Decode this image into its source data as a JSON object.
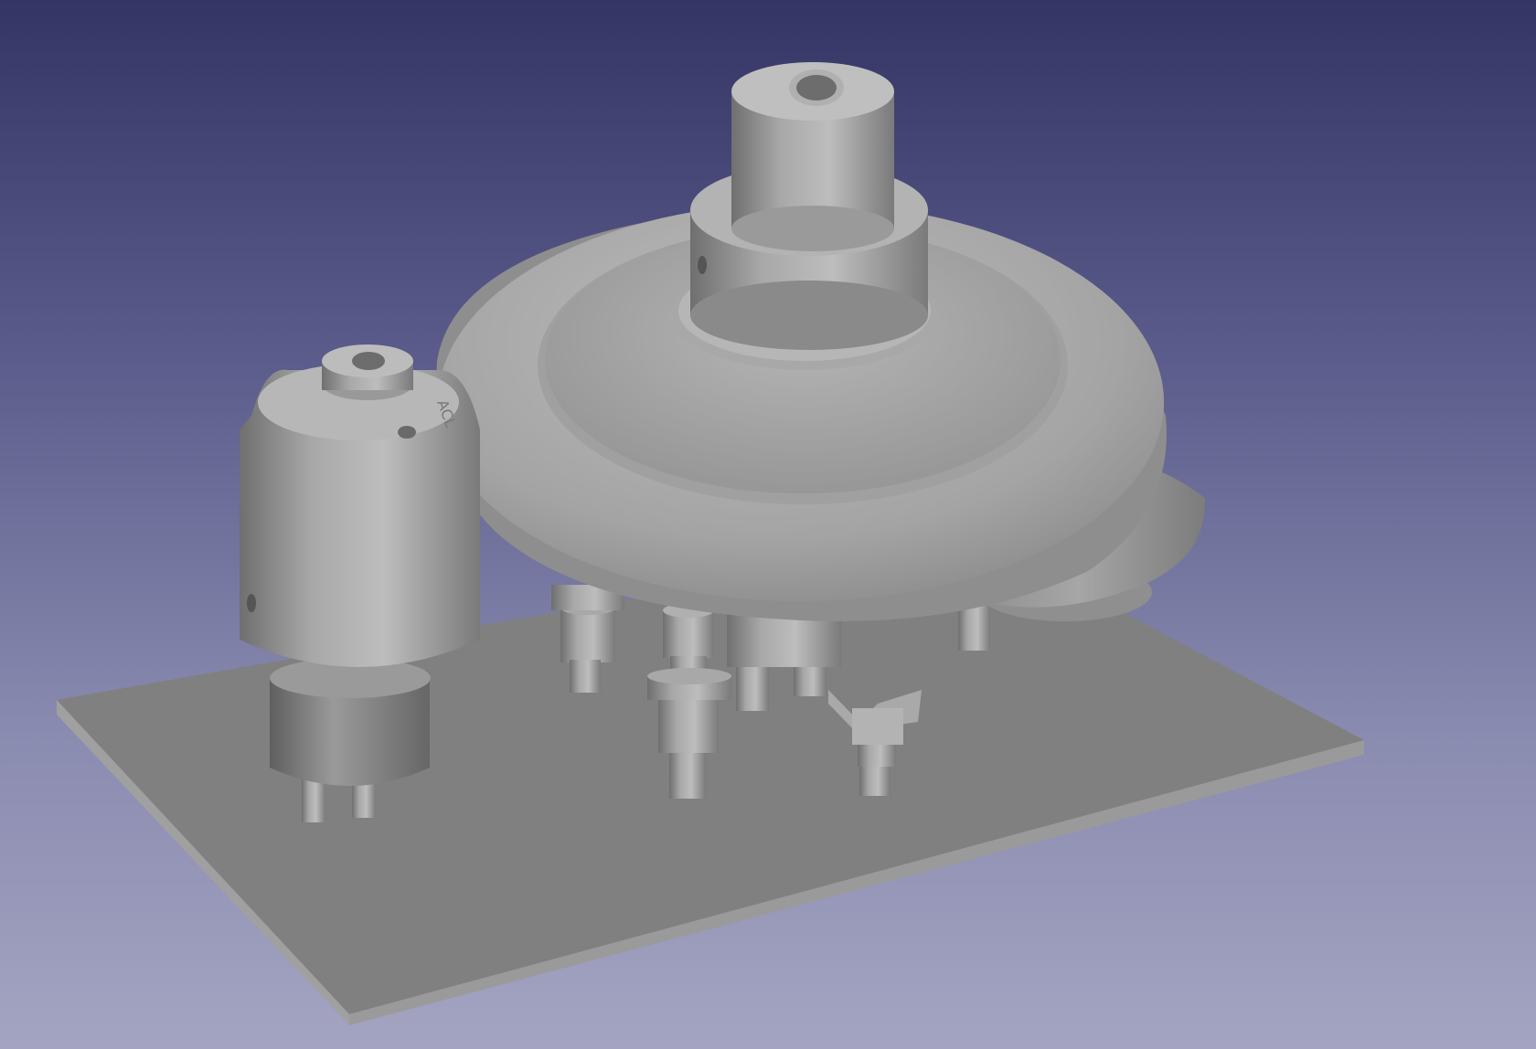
{
  "viewport": {
    "background_top": "#343564",
    "background_bottom": "#a4a4c2"
  },
  "model": {
    "part_color": "#9a9a9a",
    "board_color": "#7f7f7f",
    "board_edge_color": "#9c9c9c",
    "part_label": "ACL"
  }
}
